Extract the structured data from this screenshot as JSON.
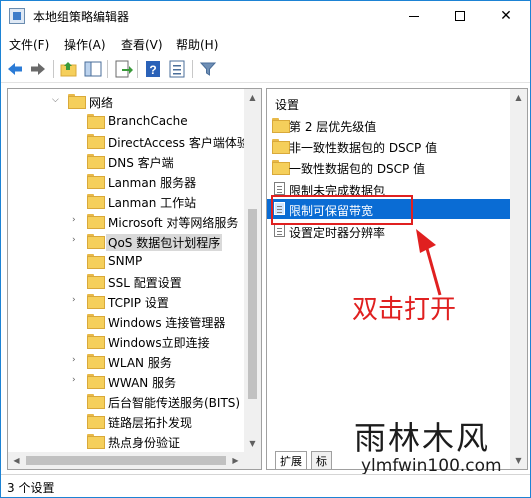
{
  "window": {
    "title": "本地组策略编辑器"
  },
  "menu": [
    "文件(F)",
    "操作(A)",
    "查看(V)",
    "帮助(H)"
  ],
  "toolbar": {
    "icons": [
      "back-icon",
      "forward-icon",
      "up-folder-icon",
      "show-tree-icon",
      "export-icon",
      "help-icon",
      "properties-icon",
      "filter-icon"
    ]
  },
  "tree": {
    "items": [
      {
        "label": "网络",
        "expanded": true
      },
      {
        "label": "BranchCache"
      },
      {
        "label": "DirectAccess 客户端体验"
      },
      {
        "label": "DNS 客户端"
      },
      {
        "label": "Lanman 服务器"
      },
      {
        "label": "Lanman 工作站"
      },
      {
        "label": "Microsoft 对等网络服务"
      },
      {
        "label": "QoS 数据包计划程序",
        "selected": true
      },
      {
        "label": "SNMP"
      },
      {
        "label": "SSL 配置设置"
      },
      {
        "label": "TCPIP 设置"
      },
      {
        "label": "Windows 连接管理器"
      },
      {
        "label": "Windows立即连接"
      },
      {
        "label": "WLAN 服务"
      },
      {
        "label": "WWAN 服务"
      },
      {
        "label": "后台智能传送服务(BITS)"
      },
      {
        "label": "链路层拓扑发现"
      },
      {
        "label": "热点身份验证"
      }
    ]
  },
  "details": {
    "header": "设置",
    "items": [
      {
        "label": "第 2 层优先级值",
        "type": "folder"
      },
      {
        "label": "非一致性数据包的 DSCP 值",
        "type": "folder"
      },
      {
        "label": "一致性数据包的 DSCP 值",
        "type": "folder"
      },
      {
        "label": "限制未完成数据包",
        "type": "setting"
      },
      {
        "label": "限制可保留带宽",
        "type": "setting",
        "selected": true
      },
      {
        "label": "设置定时器分辨率",
        "type": "setting"
      }
    ],
    "tabs": [
      "扩展",
      "标"
    ]
  },
  "annotation": {
    "text": "双击打开",
    "color": "#e02020"
  },
  "watermark": {
    "site_name": "雨林木风",
    "url": "ylmfwin100.com"
  },
  "status": {
    "text": "3 个设置"
  },
  "colors": {
    "selection": "#0a6cd4",
    "accent_red": "#e02020",
    "folder": "#f5cf5b"
  }
}
